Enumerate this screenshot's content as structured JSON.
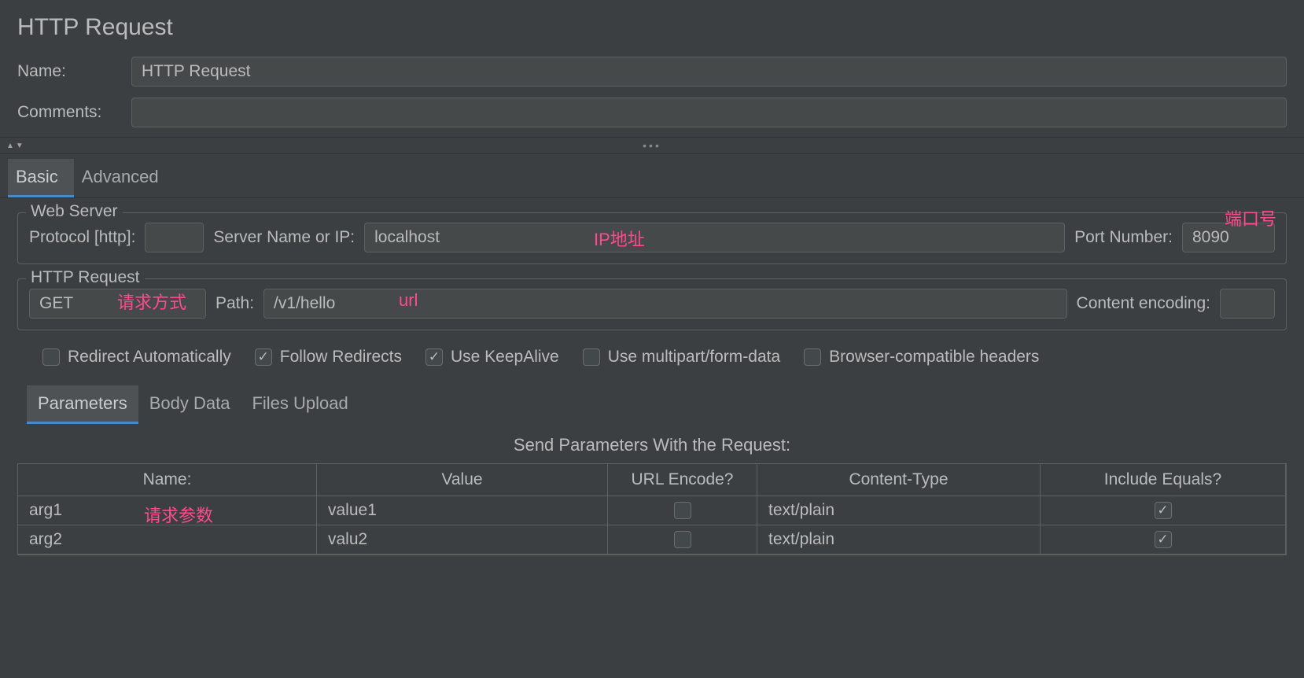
{
  "title": "HTTP Request",
  "nameLabel": "Name:",
  "nameValue": "HTTP Request",
  "commentsLabel": "Comments:",
  "commentsValue": "",
  "tabs": {
    "basic": "Basic",
    "advanced": "Advanced"
  },
  "webServer": {
    "legend": "Web Server",
    "protocolLabel": "Protocol [http]:",
    "protocolValue": "",
    "serverLabel": "Server Name or IP:",
    "serverValue": "localhost",
    "portLabel": "Port Number:",
    "portValue": "8090"
  },
  "httpRequest": {
    "legend": "HTTP Request",
    "method": "GET",
    "pathLabel": "Path:",
    "pathValue": "/v1/hello",
    "encodingLabel": "Content encoding:",
    "encodingValue": ""
  },
  "checks": {
    "redirectAuto": "Redirect Automatically",
    "followRedirects": "Follow Redirects",
    "keepAlive": "Use KeepAlive",
    "multipart": "Use multipart/form-data",
    "browserHeaders": "Browser-compatible headers"
  },
  "innerTabs": {
    "params": "Parameters",
    "body": "Body Data",
    "files": "Files Upload"
  },
  "paramsHeading": "Send Parameters With the Request:",
  "tableHeaders": {
    "name": "Name:",
    "value": "Value",
    "encode": "URL Encode?",
    "ctype": "Content-Type",
    "include": "Include Equals?"
  },
  "rows": [
    {
      "name": "arg1",
      "value": "value1",
      "encode": false,
      "ctype": "text/plain",
      "include": true
    },
    {
      "name": "arg2",
      "value": "valu2",
      "encode": false,
      "ctype": "text/plain",
      "include": true
    }
  ],
  "annotations": {
    "ip": "IP地址",
    "port": "端口号",
    "method": "请求方式",
    "url": "url",
    "params": "请求参数"
  }
}
